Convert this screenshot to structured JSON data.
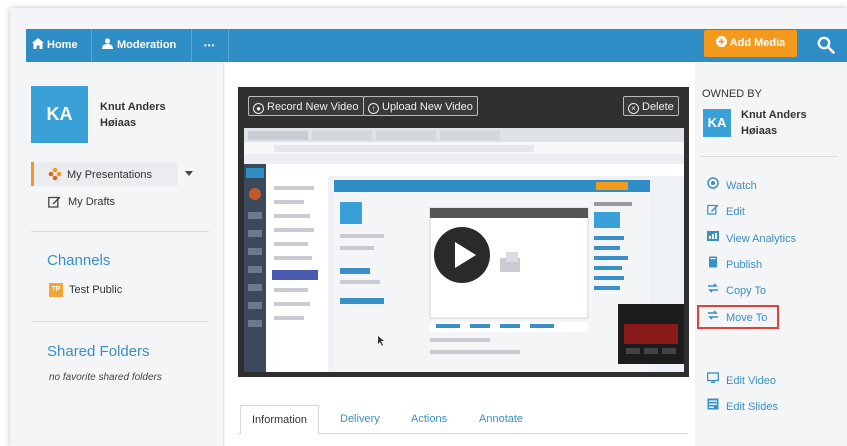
{
  "nav": {
    "home_label": "Home",
    "moderation_label": "Moderation",
    "more_label": "•••",
    "add_media_label": "Add Media"
  },
  "colors": {
    "nav_bg": "#2e8dc4",
    "accent_orange": "#f39a1d",
    "link_blue": "#3a8fc6",
    "avatar_blue": "#3aa0d8",
    "highlight_red": "#e04038"
  },
  "user": {
    "initials": "KA",
    "first_line": "Knut Anders",
    "second_line": "Høiaas"
  },
  "sidebar": {
    "my_presentations_label": "My Presentations",
    "my_drafts_label": "My Drafts",
    "channels_title": "Channels",
    "channel_badge": "TP",
    "channel_name": "Test Public",
    "shared_folders_title": "Shared Folders",
    "shared_folders_empty": "no favorite shared folders"
  },
  "player": {
    "record_label": "Record New Video",
    "upload_label": "Upload New Video",
    "delete_label": "Delete"
  },
  "tabs": [
    "Information",
    "Delivery",
    "Actions",
    "Annotate"
  ],
  "owner": {
    "title": "OWNED BY",
    "initials": "KA",
    "first_line": "Knut Anders",
    "second_line": "Høiaas"
  },
  "actions": {
    "watch": "Watch",
    "edit": "Edit",
    "view_analytics": "View Analytics",
    "publish": "Publish",
    "copy_to": "Copy To",
    "move_to": "Move To",
    "edit_video": "Edit Video",
    "edit_slides": "Edit Slides"
  }
}
